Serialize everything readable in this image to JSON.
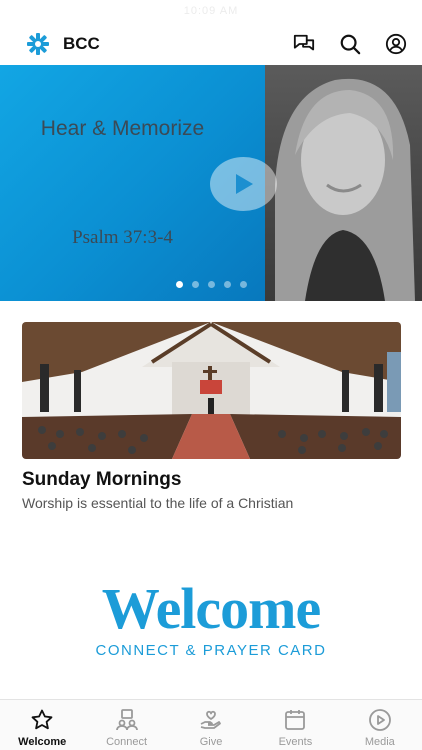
{
  "status_bar": {
    "time": "10:09 AM"
  },
  "header": {
    "brand": "BCC"
  },
  "carousel": {
    "slide_title": "Hear & Memorize",
    "slide_verse": "Psalm 37:3-4",
    "dot_count": 5,
    "active_dot": 0
  },
  "feature_card": {
    "title": "Sunday Mornings",
    "subtitle": "Worship is essential to the life of a Christian"
  },
  "welcome_banner": {
    "headline": "Welcome",
    "subline": "CONNECT & PRAYER CARD"
  },
  "tabs": [
    {
      "label": "Welcome",
      "icon": "star-icon",
      "active": true
    },
    {
      "label": "Connect",
      "icon": "people-icon",
      "active": false
    },
    {
      "label": "Give",
      "icon": "give-hand-icon",
      "active": false
    },
    {
      "label": "Events",
      "icon": "calendar-icon",
      "active": false
    },
    {
      "label": "Media",
      "icon": "play-circle-icon",
      "active": false
    }
  ],
  "colors": {
    "accent": "#1c9cd8",
    "slide_blue": "#0b8fd2"
  }
}
